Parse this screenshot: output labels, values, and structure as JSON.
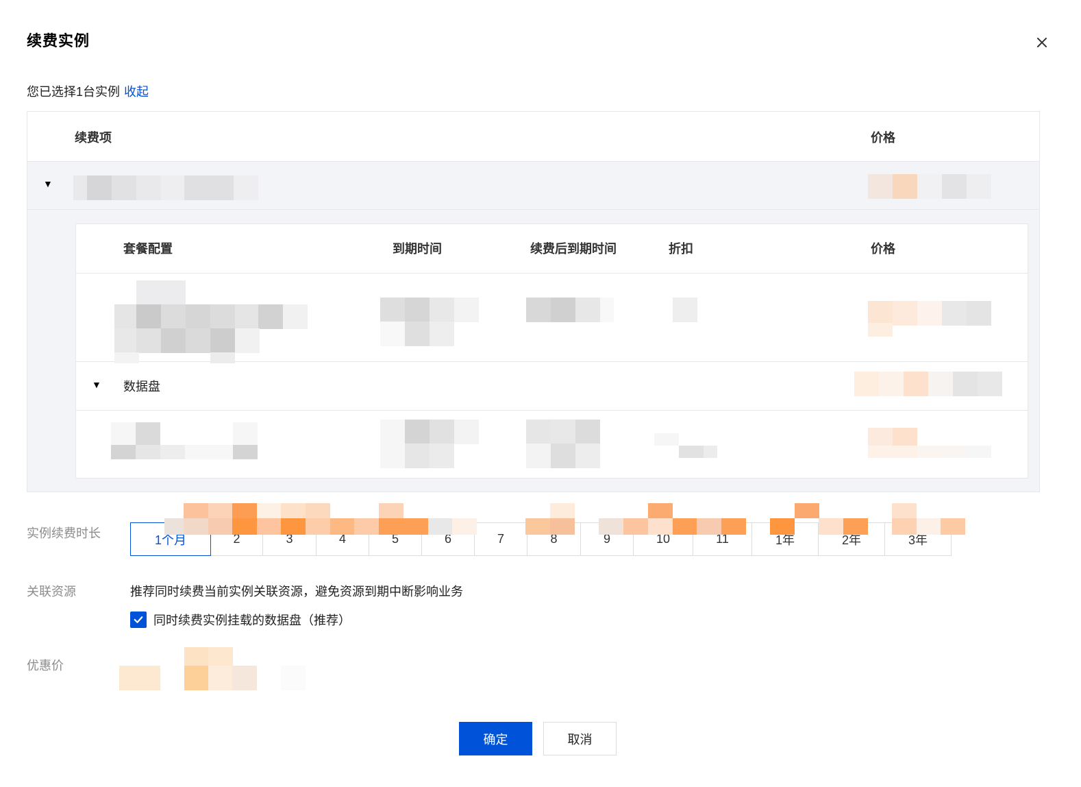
{
  "dialog": {
    "title": "续费实例",
    "close_icon": "close-icon"
  },
  "selection": {
    "text": "您已选择1台实例",
    "collapse_label": "收起"
  },
  "outer_table": {
    "headers": {
      "item": "续费项",
      "price": "价格"
    }
  },
  "inner_table": {
    "headers": {
      "package": "套餐配置",
      "expire": "到期时间",
      "after_renew_expire": "续费后到期时间",
      "discount": "折扣",
      "price": "价格"
    },
    "disk_group_label": "数据盘"
  },
  "renew": {
    "label": "实例续费时长",
    "options": [
      "1个月",
      "2",
      "3",
      "4",
      "5",
      "6",
      "7",
      "8",
      "9",
      "10",
      "11",
      "1年",
      "2年",
      "3年"
    ],
    "selected": "1个月"
  },
  "related": {
    "label": "关联资源",
    "hint": "推荐同时续费当前实例关联资源，避免资源到期中断影响业务",
    "checkbox_label": "同时续费实例挂载的数据盘（推荐）",
    "checked": true
  },
  "discount_price": {
    "label": "优惠价"
  },
  "footer": {
    "confirm_label": "确定",
    "cancel_label": "取消"
  },
  "colors": {
    "primary": "#0052d9",
    "border": "#e7e7e7",
    "row_bg": "#f3f4f7"
  }
}
